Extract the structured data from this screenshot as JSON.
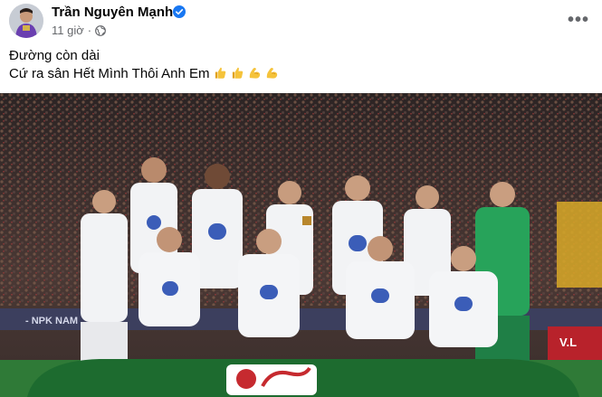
{
  "post": {
    "author_name": "Trần Nguyên Mạnh",
    "timestamp": "11 giờ",
    "separator": "·",
    "privacy_icon": "globe-icon",
    "verified_icon": "verified-badge-icon",
    "more_icon": "more-options-icon",
    "more_label": "•••",
    "text_lines": [
      "Đường còn dài",
      "Cứ ra sân Hết Mình Thôi Anh Em"
    ],
    "emojis": [
      "thumbs-up",
      "thumbs-up",
      "flexed-biceps",
      "flexed-biceps"
    ]
  },
  "photo": {
    "description_icon": "team-photo",
    "sponsor_text": "V.L",
    "banner_text": "- NPK NAM",
    "colors": {
      "crowd": "#3a2e2c",
      "kit": "#f2f3f5",
      "kit_accent": "#b8862c",
      "keeper": "#27a35a",
      "pitch": "#2f7a37",
      "board": "#b8222b"
    }
  },
  "colors": {
    "name": "#050505",
    "meta": "#65676b",
    "verified": "#1877f2"
  }
}
